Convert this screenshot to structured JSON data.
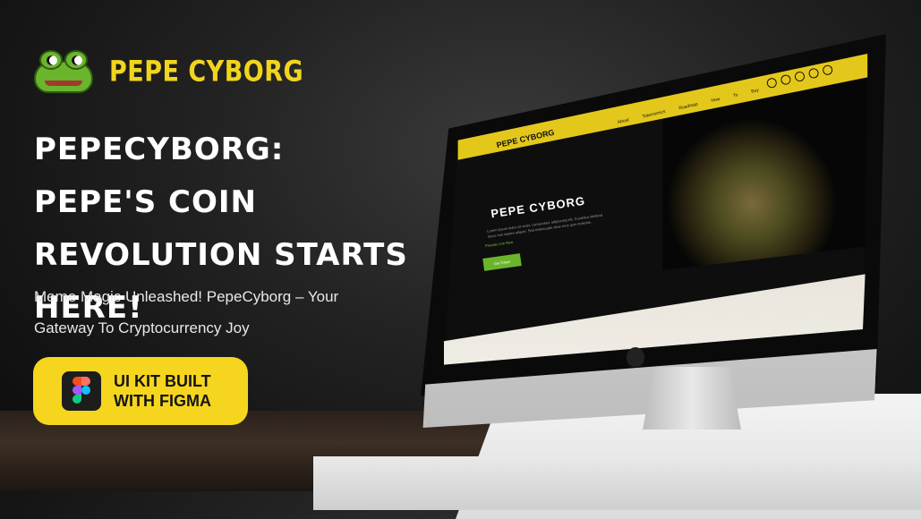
{
  "brand": {
    "name": "PEPE CYBORG",
    "icon": "frog-logo-icon"
  },
  "headline": "PEPECYBORG: PEPE'S COIN REVOLUTION STARTS HERE!",
  "subheadline": "Meme Magic Unleashed! PepeCyborg – Your Gateway To Cryptocurrency Joy",
  "cta": {
    "label": "UI KIT BUILT\nWITH FIGMA",
    "icon": "figma-icon"
  },
  "colors": {
    "accent": "#F6D51E",
    "background": "#1A1A1A",
    "brand_green": "#6BB52C"
  },
  "screen_preview": {
    "brand": "PEPE CYBORG",
    "menu": [
      "About",
      "Tokenomics",
      "Roadmap",
      "How To Buy"
    ],
    "social_icons": [
      "facebook-icon",
      "twitter-icon",
      "instagram-icon",
      "linkedin-icon",
      "discord-icon"
    ],
    "hero_title": "PEPE CYBORG",
    "hero_text": "Lorem ipsum dolor sit amet, consectetur adipiscing elit. Curabitur eleifend lacus non sapien aliquet. Sed malesuada vitae eros quis molestie.",
    "presale": "Presale Live Now",
    "button": "Get Token"
  }
}
